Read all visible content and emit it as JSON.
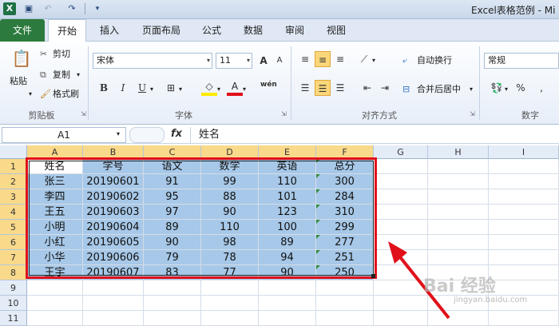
{
  "window": {
    "title": "Excel表格范例 - Mi"
  },
  "tabs": [
    {
      "label": "文件"
    },
    {
      "label": "开始"
    },
    {
      "label": "插入"
    },
    {
      "label": "页面布局"
    },
    {
      "label": "公式"
    },
    {
      "label": "数据"
    },
    {
      "label": "审阅"
    },
    {
      "label": "视图"
    }
  ],
  "ribbon": {
    "clipboard": {
      "group": "剪贴板",
      "paste": "粘贴",
      "cut": "剪切",
      "copy": "复制",
      "format_painter": "格式刷"
    },
    "font": {
      "group": "字体",
      "font_name": "宋体",
      "font_size": "11",
      "bold": "B",
      "italic": "I",
      "underline": "U",
      "grow": "A",
      "shrink": "A",
      "wen": "wén"
    },
    "alignment": {
      "group": "对齐方式",
      "wrap": "自动换行",
      "merge": "合并后居中"
    },
    "number": {
      "group": "数字",
      "format": "常规",
      "percent": "%"
    }
  },
  "formula_bar": {
    "name_box": "A1",
    "fx": "fx",
    "value": "姓名"
  },
  "columns": [
    "A",
    "B",
    "C",
    "D",
    "E",
    "F",
    "G",
    "H",
    "I"
  ],
  "rows": [
    "1",
    "2",
    "3",
    "4",
    "5",
    "6",
    "7",
    "8",
    "9",
    "10",
    "11"
  ],
  "table": [
    [
      "姓名",
      "学号",
      "语文",
      "数学",
      "英语",
      "总分"
    ],
    [
      "张三",
      "20190601",
      "91",
      "99",
      "110",
      "300"
    ],
    [
      "李四",
      "20190602",
      "95",
      "88",
      "101",
      "284"
    ],
    [
      "王五",
      "20190603",
      "97",
      "90",
      "123",
      "310"
    ],
    [
      "小明",
      "20190604",
      "89",
      "110",
      "100",
      "299"
    ],
    [
      "小红",
      "20190605",
      "90",
      "98",
      "89",
      "277"
    ],
    [
      "小华",
      "20190606",
      "79",
      "78",
      "94",
      "251"
    ],
    [
      "王宇",
      "20190607",
      "83",
      "77",
      "90",
      "250"
    ]
  ],
  "annotation": {
    "color": "#e0101a"
  },
  "watermark": {
    "text": "Bai 经验",
    "sub": "jingyan.baidu.com"
  },
  "colors": {
    "accent": "#2c7a3d",
    "selection": "#a7c8e8",
    "highlight": "#e0101a"
  }
}
